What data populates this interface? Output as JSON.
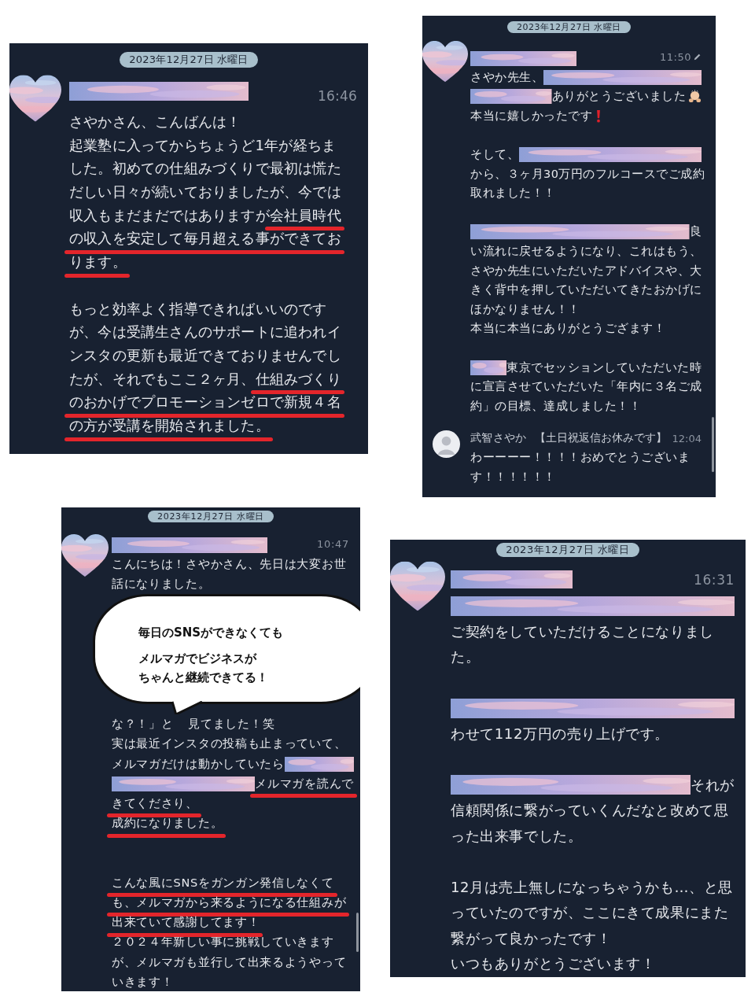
{
  "panels": [
    {
      "date": "2023年12月27日 水曜日",
      "messages": [
        {
          "kind": "masked",
          "edited": false,
          "time": "16:46",
          "lines": [
            {
              "kind": "line",
              "segments": [
                {
                  "kind": "plain",
                  "text": "さやかさん、こんばんは！"
                }
              ]
            },
            {
              "kind": "line",
              "segments": [
                {
                  "kind": "plain",
                  "text": "起業塾に入ってからちょうど1年が経ちま"
                }
              ]
            },
            {
              "kind": "line",
              "segments": [
                {
                  "kind": "plain",
                  "text": "した。初めての仕組みづくりで最初は慌た"
                }
              ]
            },
            {
              "kind": "line",
              "segments": [
                {
                  "kind": "plain",
                  "text": "だしい日々が続いておりましたが、今では"
                }
              ]
            },
            {
              "kind": "line",
              "segments": [
                {
                  "kind": "plain",
                  "text": "収入もまだまだではありますが"
                },
                {
                  "kind": "marked",
                  "text": "会社員時代"
                }
              ]
            },
            {
              "kind": "line",
              "segments": [
                {
                  "kind": "marked",
                  "text": "の収入を安定して毎月超える事ができてお"
                }
              ]
            },
            {
              "kind": "line",
              "segments": [
                {
                  "kind": "marked",
                  "text": "ります。"
                }
              ]
            },
            {
              "kind": "gap"
            },
            {
              "kind": "line",
              "segments": [
                {
                  "kind": "plain",
                  "text": "もっと効率よく指導できればいいのです"
                }
              ]
            },
            {
              "kind": "line",
              "segments": [
                {
                  "kind": "plain",
                  "text": "が、今は受講生さんのサポートに追われイ"
                }
              ]
            },
            {
              "kind": "line",
              "segments": [
                {
                  "kind": "plain",
                  "text": "ンスタの更新も最近できておりませんでし"
                }
              ]
            },
            {
              "kind": "line",
              "segments": [
                {
                  "kind": "plain",
                  "text": "たが、それでもここ２ヶ月、"
                },
                {
                  "kind": "marked",
                  "text": "仕組みづくり"
                }
              ]
            },
            {
              "kind": "line",
              "segments": [
                {
                  "kind": "marked",
                  "text": "のおかげでプロモーションゼロで新規４名"
                }
              ]
            },
            {
              "kind": "line",
              "segments": [
                {
                  "kind": "marked",
                  "text": "の方が受講を開始されました。"
                }
              ]
            }
          ]
        }
      ]
    },
    {
      "date": "2023年12月27日 水曜日",
      "messages": [
        {
          "kind": "masked",
          "edited": true,
          "time": "11:50",
          "lines": [
            {
              "kind": "line",
              "segments": [
                {
                  "kind": "plain",
                  "text": "さやか先生、"
                },
                {
                  "kind": "mask"
                }
              ]
            },
            {
              "kind": "line",
              "segments": [
                {
                  "kind": "mask"
                },
                {
                  "kind": "plain",
                  "text": "ありがとうございました"
                },
                {
                  "kind": "emoji"
                }
              ]
            },
            {
              "kind": "line",
              "segments": [
                {
                  "kind": "plain",
                  "text": "本当に嬉しかったです"
                },
                {
                  "kind": "exclaim"
                }
              ]
            },
            {
              "kind": "gap"
            },
            {
              "kind": "line",
              "segments": [
                {
                  "kind": "plain",
                  "text": "そして、"
                },
                {
                  "kind": "mask"
                }
              ]
            },
            {
              "kind": "line",
              "segments": [
                {
                  "kind": "plain",
                  "text": "から、３ヶ月30万円のフルコースでご成約"
                }
              ]
            },
            {
              "kind": "line",
              "segments": [
                {
                  "kind": "plain",
                  "text": "取れました！！"
                }
              ]
            },
            {
              "kind": "gap"
            },
            {
              "kind": "line",
              "segments": [
                {
                  "kind": "mask"
                },
                {
                  "kind": "plain",
                  "text": "良"
                }
              ]
            },
            {
              "kind": "line",
              "segments": [
                {
                  "kind": "plain",
                  "text": "い流れに戻せるようになり、これはもう、"
                }
              ]
            },
            {
              "kind": "line",
              "segments": [
                {
                  "kind": "plain",
                  "text": "さやか先生にいただいたアドバイスや、大"
                }
              ]
            },
            {
              "kind": "line",
              "segments": [
                {
                  "kind": "plain",
                  "text": "きく背中を押していただいてきたおかげに"
                }
              ]
            },
            {
              "kind": "line",
              "segments": [
                {
                  "kind": "plain",
                  "text": "ほかなりません！！"
                }
              ]
            },
            {
              "kind": "line",
              "segments": [
                {
                  "kind": "plain",
                  "text": "本当に本当にありがとうござます！"
                }
              ]
            },
            {
              "kind": "gap"
            },
            {
              "kind": "line",
              "segments": [
                {
                  "kind": "mask"
                },
                {
                  "kind": "plain",
                  "text": "東京でセッションしていただいた時"
                }
              ]
            },
            {
              "kind": "line",
              "segments": [
                {
                  "kind": "plain",
                  "text": "に宣言させていただいた「年内に３名ご成"
                }
              ]
            },
            {
              "kind": "line",
              "segments": [
                {
                  "kind": "plain",
                  "text": "約」の目標、達成しました！！"
                }
              ]
            }
          ]
        },
        {
          "kind": "named",
          "edited": false,
          "name": "武智さやか",
          "tag": "【土日祝返信お休みです】",
          "time": "12:04",
          "lines": [
            {
              "kind": "line",
              "segments": [
                {
                  "kind": "plain",
                  "text": "わーーーー！！！！おめでとうございま"
                }
              ]
            },
            {
              "kind": "line",
              "segments": [
                {
                  "kind": "plain",
                  "text": "す！！！！！！"
                }
              ]
            }
          ]
        }
      ]
    },
    {
      "date": "2023年12月27日 水曜日",
      "messages": [
        {
          "kind": "masked",
          "edited": false,
          "time": "10:47",
          "lines": [
            {
              "kind": "line",
              "segments": [
                {
                  "kind": "plain",
                  "text": "こんにちは！さやかさん、先日は大変お世"
                }
              ]
            },
            {
              "kind": "line",
              "segments": [
                {
                  "kind": "plain",
                  "text": "話になりました。"
                }
              ]
            },
            {
              "kind": "callout",
              "lines": [
                "毎日のSNSができなくても",
                "メルマガでビジネスが",
                "ちゃんと継続できてる！"
              ]
            },
            {
              "kind": "line",
              "segments": [
                {
                  "kind": "plain",
                  "text": "な？！」と"
                },
                {
                  "kind": "plain",
                  "text": "見てました！笑"
                }
              ]
            },
            {
              "kind": "line",
              "segments": [
                {
                  "kind": "plain",
                  "text": "実は最近インスタの投稿も止まっていて、"
                }
              ]
            },
            {
              "kind": "line",
              "segments": [
                {
                  "kind": "plain",
                  "text": "メルマガだけは動かしていたら"
                },
                {
                  "kind": "mask"
                }
              ]
            },
            {
              "kind": "line",
              "segments": [
                {
                  "kind": "mask"
                },
                {
                  "kind": "marked",
                  "text": "メルマガを読んで"
                }
              ]
            },
            {
              "kind": "line",
              "segments": [
                {
                  "kind": "marked",
                  "text": "きてくださり、"
                }
              ]
            },
            {
              "kind": "line",
              "segments": [
                {
                  "kind": "marked",
                  "text": "成約になりました。"
                }
              ]
            },
            {
              "kind": "gap"
            },
            {
              "kind": "gap"
            },
            {
              "kind": "line",
              "segments": [
                {
                  "kind": "marked",
                  "text": "こんな風にSNSをガンガン発信しなくて"
                }
              ]
            },
            {
              "kind": "line",
              "segments": [
                {
                  "kind": "marked",
                  "text": "も、メルマガから来るようになる仕組みが"
                }
              ]
            },
            {
              "kind": "line",
              "segments": [
                {
                  "kind": "marked",
                  "text": "出来ていて感謝してます！"
                }
              ]
            },
            {
              "kind": "line",
              "segments": [
                {
                  "kind": "plain",
                  "text": "２０２４年新しい事に挑戦していきます"
                }
              ]
            },
            {
              "kind": "line",
              "segments": [
                {
                  "kind": "plain",
                  "text": "が、メルマガも並行して出来るようやって"
                }
              ]
            },
            {
              "kind": "line",
              "segments": [
                {
                  "kind": "plain",
                  "text": "いきます！"
                }
              ]
            }
          ]
        }
      ]
    },
    {
      "date": "2023年12月27日 水曜日",
      "messages": [
        {
          "kind": "masked",
          "edited": false,
          "time": "16:31",
          "lines": [
            {
              "kind": "line",
              "segments": [
                {
                  "kind": "mask"
                }
              ]
            },
            {
              "kind": "line",
              "segments": [
                {
                  "kind": "plain",
                  "text": "ご契約をしていただけることになりまし"
                }
              ]
            },
            {
              "kind": "line",
              "segments": [
                {
                  "kind": "plain",
                  "text": "た。"
                }
              ]
            },
            {
              "kind": "gap"
            },
            {
              "kind": "line",
              "segments": [
                {
                  "kind": "mask"
                }
              ]
            },
            {
              "kind": "line",
              "segments": [
                {
                  "kind": "plain",
                  "text": "わせて112万円の売り上げです。"
                }
              ]
            },
            {
              "kind": "gap"
            },
            {
              "kind": "line",
              "segments": [
                {
                  "kind": "mask"
                },
                {
                  "kind": "plain",
                  "text": "それが"
                }
              ]
            },
            {
              "kind": "line",
              "segments": [
                {
                  "kind": "plain",
                  "text": "信頼関係に繋がっていくんだなと改めて思"
                }
              ]
            },
            {
              "kind": "line",
              "segments": [
                {
                  "kind": "plain",
                  "text": "った出来事でした。"
                }
              ]
            },
            {
              "kind": "gap"
            },
            {
              "kind": "line",
              "segments": [
                {
                  "kind": "plain",
                  "text": "12月は売上無しになっちゃうかも…、と思"
                }
              ]
            },
            {
              "kind": "line",
              "segments": [
                {
                  "kind": "plain",
                  "text": "っていたのですが、ここにきて成果にまた"
                }
              ]
            },
            {
              "kind": "line",
              "segments": [
                {
                  "kind": "plain",
                  "text": "繋がって良かったです！"
                }
              ]
            },
            {
              "kind": "line",
              "segments": [
                {
                  "kind": "plain",
                  "text": "いつもありがとうございます！"
                }
              ]
            }
          ]
        }
      ]
    }
  ]
}
